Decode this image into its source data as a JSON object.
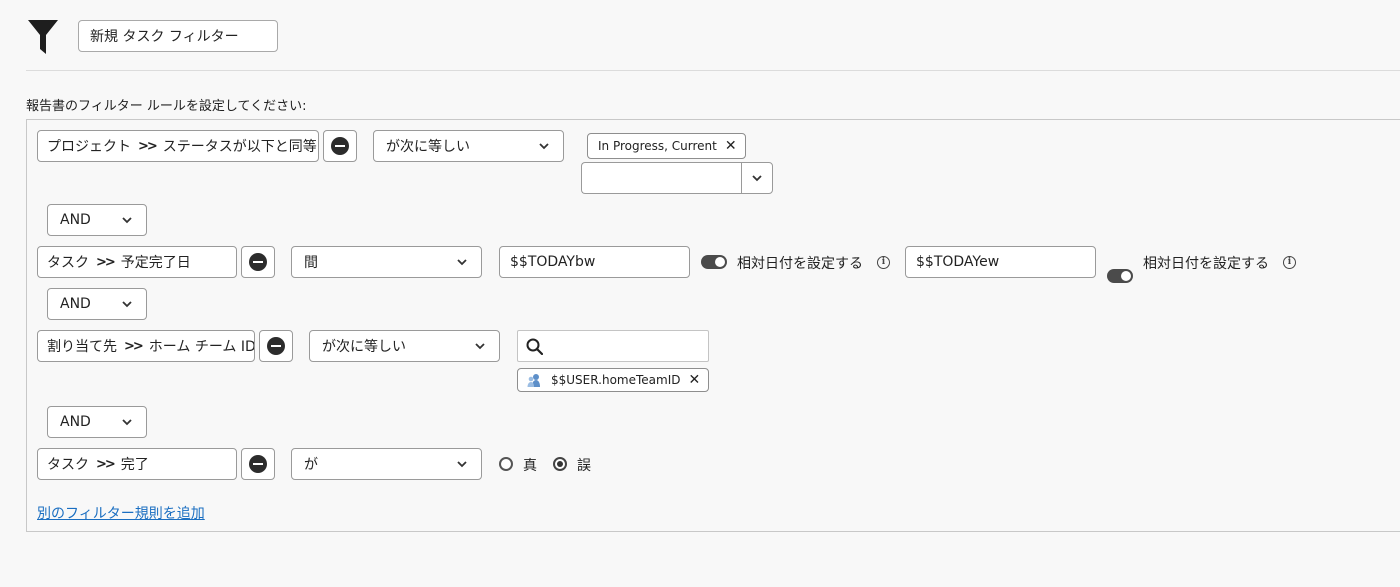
{
  "header": {
    "filter_icon": "funnel-icon",
    "filter_name": "新規 タスク フィルター"
  },
  "instructions": "報告書のフィルター ルールを設定してください:",
  "rules": [
    {
      "field_object": "プロジェクト",
      "field_separator": "»",
      "field_name": "ステータスが以下と同等",
      "operator": "が次に等しい",
      "tags": [
        "In Progress, Current"
      ],
      "combo_value": ""
    },
    {
      "field_object": "タスク",
      "field_separator": "»",
      "field_name": "予定完了日",
      "operator": "間",
      "from_value": "$$TODAYbw",
      "from_toggle_label": "相対日付を設定する",
      "to_value": "$$TODAYew",
      "to_toggle_label": "相対日付を設定する"
    },
    {
      "field_object": "割り当て先",
      "field_separator": "»",
      "field_name": "ホーム チーム ID",
      "operator": "が次に等しい",
      "search_value": "",
      "tags": [
        "$$USER.homeTeamID"
      ]
    },
    {
      "field_object": "タスク",
      "field_separator": "»",
      "field_name": "完了",
      "operator": "が",
      "radio_options": [
        "真",
        "誤"
      ],
      "radio_selected": "誤"
    }
  ],
  "connectors": [
    "AND",
    "AND",
    "AND"
  ],
  "add_rule_link": "別のフィルター規則を追加"
}
